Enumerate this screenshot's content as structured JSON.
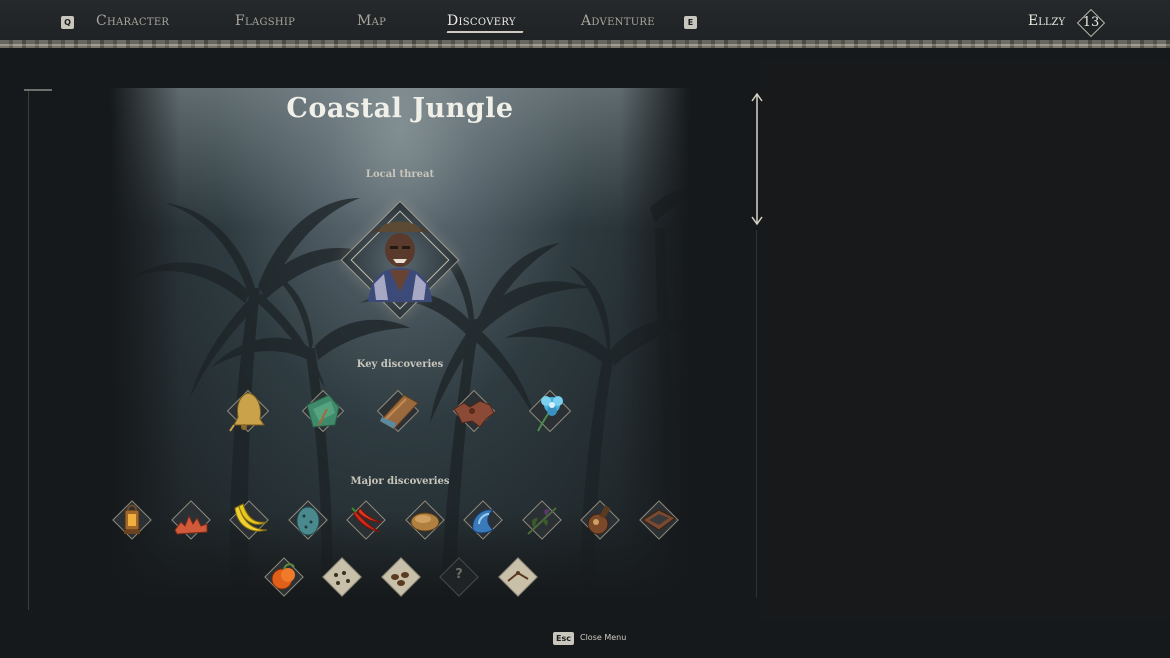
{
  "topbar": {
    "prev_key": "Q",
    "next_key": "E",
    "tabs": [
      {
        "label": "Character",
        "active": false
      },
      {
        "label": "Flagship",
        "active": false
      },
      {
        "label": "Map",
        "active": false
      },
      {
        "label": "Discovery",
        "active": true
      },
      {
        "label": "Adventure",
        "active": false
      }
    ],
    "player_name": "Ellzy",
    "level": "13"
  },
  "region": {
    "title": "Coastal Jungle",
    "local_threat_label": "Local threat",
    "local_threat_icon": "pirate-captain-portrait",
    "key_discoveries_label": "Key discoveries",
    "key_discoveries": [
      {
        "icon": "brass-bell-icon"
      },
      {
        "icon": "green-cloth-icon"
      },
      {
        "icon": "wood-plank-icon"
      },
      {
        "icon": "animal-hide-icon"
      },
      {
        "icon": "blue-flower-icon"
      }
    ],
    "major_discoveries_label": "Major discoveries",
    "major_discoveries_row1": [
      {
        "icon": "lantern-icon"
      },
      {
        "icon": "coral-icon"
      },
      {
        "icon": "banana-icon"
      },
      {
        "icon": "egg-icon"
      },
      {
        "icon": "chili-pepper-icon"
      },
      {
        "icon": "bread-loaf-icon"
      },
      {
        "icon": "blue-crystal-icon"
      },
      {
        "icon": "herb-icon"
      },
      {
        "icon": "bottle-icon"
      },
      {
        "icon": "wooden-crate-icon"
      }
    ],
    "major_discoveries_row2": [
      {
        "icon": "orange-fruit-icon"
      },
      {
        "icon": "map-fragment-icon"
      },
      {
        "icon": "map-fragment-icon"
      },
      {
        "icon": "unknown-icon",
        "label": "?"
      },
      {
        "icon": "map-fragment-icon"
      }
    ]
  },
  "footer": {
    "key": "Esc",
    "label": "Close Menu"
  },
  "colors": {
    "background": "#16191b",
    "title_text": "#f0efe8",
    "frame_border": "#8f8a7c"
  }
}
